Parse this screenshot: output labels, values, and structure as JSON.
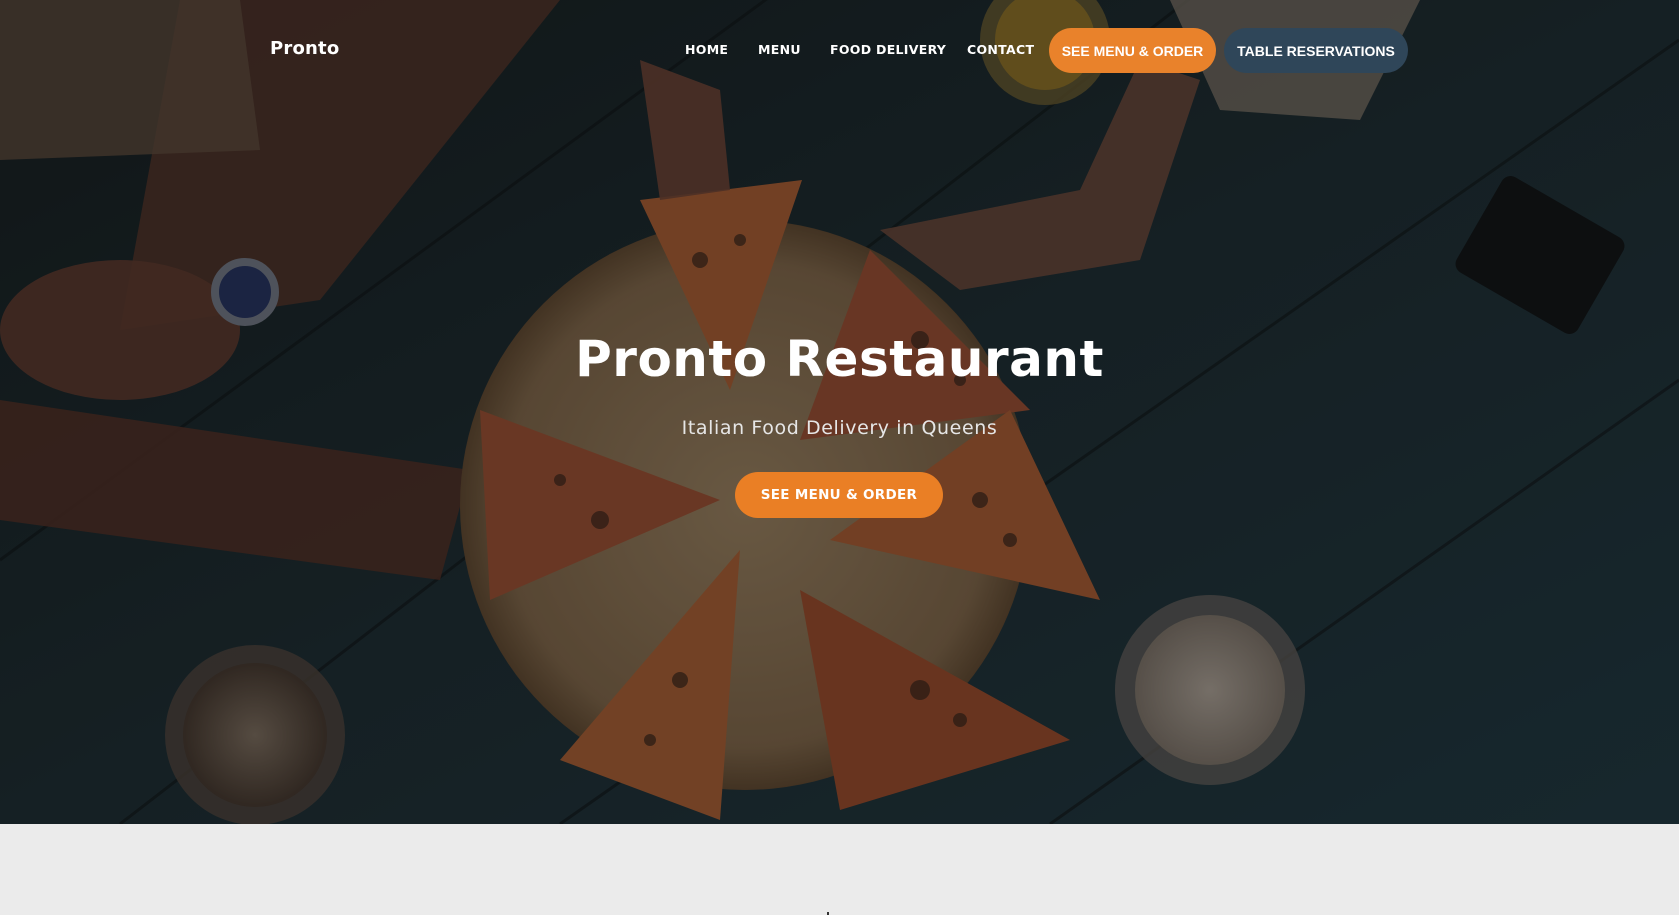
{
  "colors": {
    "accent_orange": "#ea7f25",
    "reservation_blue": "#2f4659",
    "hero_text": "#ffffff",
    "section_background": "#ebebeb"
  },
  "hero_image": {
    "description_icon": "pizza-table-photo-icon"
  },
  "navbar": {
    "brand": "Pronto",
    "links": [
      "HOME",
      "MENU",
      "FOOD DELIVERY",
      "CONTACT"
    ],
    "order_button": "SEE MENU & ORDER",
    "reservation_button": "TABLE RESERVATIONS"
  },
  "hero": {
    "title": "Pronto Restaurant",
    "subtitle": "Italian Food Delivery in Queens",
    "cta": "SEE MENU & ORDER"
  }
}
